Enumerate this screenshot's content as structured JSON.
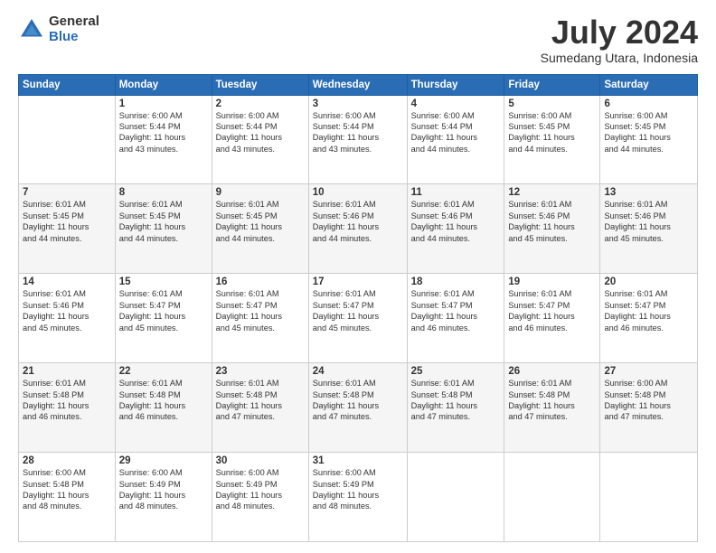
{
  "logo": {
    "general": "General",
    "blue": "Blue"
  },
  "header": {
    "month": "July 2024",
    "location": "Sumedang Utara, Indonesia"
  },
  "weekdays": [
    "Sunday",
    "Monday",
    "Tuesday",
    "Wednesday",
    "Thursday",
    "Friday",
    "Saturday"
  ],
  "weeks": [
    [
      {
        "day": "",
        "info": ""
      },
      {
        "day": "1",
        "info": "Sunrise: 6:00 AM\nSunset: 5:44 PM\nDaylight: 11 hours\nand 43 minutes."
      },
      {
        "day": "2",
        "info": "Sunrise: 6:00 AM\nSunset: 5:44 PM\nDaylight: 11 hours\nand 43 minutes."
      },
      {
        "day": "3",
        "info": "Sunrise: 6:00 AM\nSunset: 5:44 PM\nDaylight: 11 hours\nand 43 minutes."
      },
      {
        "day": "4",
        "info": "Sunrise: 6:00 AM\nSunset: 5:44 PM\nDaylight: 11 hours\nand 44 minutes."
      },
      {
        "day": "5",
        "info": "Sunrise: 6:00 AM\nSunset: 5:45 PM\nDaylight: 11 hours\nand 44 minutes."
      },
      {
        "day": "6",
        "info": "Sunrise: 6:00 AM\nSunset: 5:45 PM\nDaylight: 11 hours\nand 44 minutes."
      }
    ],
    [
      {
        "day": "7",
        "info": "Sunrise: 6:01 AM\nSunset: 5:45 PM\nDaylight: 11 hours\nand 44 minutes."
      },
      {
        "day": "8",
        "info": "Sunrise: 6:01 AM\nSunset: 5:45 PM\nDaylight: 11 hours\nand 44 minutes."
      },
      {
        "day": "9",
        "info": "Sunrise: 6:01 AM\nSunset: 5:45 PM\nDaylight: 11 hours\nand 44 minutes."
      },
      {
        "day": "10",
        "info": "Sunrise: 6:01 AM\nSunset: 5:46 PM\nDaylight: 11 hours\nand 44 minutes."
      },
      {
        "day": "11",
        "info": "Sunrise: 6:01 AM\nSunset: 5:46 PM\nDaylight: 11 hours\nand 44 minutes."
      },
      {
        "day": "12",
        "info": "Sunrise: 6:01 AM\nSunset: 5:46 PM\nDaylight: 11 hours\nand 45 minutes."
      },
      {
        "day": "13",
        "info": "Sunrise: 6:01 AM\nSunset: 5:46 PM\nDaylight: 11 hours\nand 45 minutes."
      }
    ],
    [
      {
        "day": "14",
        "info": "Sunrise: 6:01 AM\nSunset: 5:46 PM\nDaylight: 11 hours\nand 45 minutes."
      },
      {
        "day": "15",
        "info": "Sunrise: 6:01 AM\nSunset: 5:47 PM\nDaylight: 11 hours\nand 45 minutes."
      },
      {
        "day": "16",
        "info": "Sunrise: 6:01 AM\nSunset: 5:47 PM\nDaylight: 11 hours\nand 45 minutes."
      },
      {
        "day": "17",
        "info": "Sunrise: 6:01 AM\nSunset: 5:47 PM\nDaylight: 11 hours\nand 45 minutes."
      },
      {
        "day": "18",
        "info": "Sunrise: 6:01 AM\nSunset: 5:47 PM\nDaylight: 11 hours\nand 46 minutes."
      },
      {
        "day": "19",
        "info": "Sunrise: 6:01 AM\nSunset: 5:47 PM\nDaylight: 11 hours\nand 46 minutes."
      },
      {
        "day": "20",
        "info": "Sunrise: 6:01 AM\nSunset: 5:47 PM\nDaylight: 11 hours\nand 46 minutes."
      }
    ],
    [
      {
        "day": "21",
        "info": "Sunrise: 6:01 AM\nSunset: 5:48 PM\nDaylight: 11 hours\nand 46 minutes."
      },
      {
        "day": "22",
        "info": "Sunrise: 6:01 AM\nSunset: 5:48 PM\nDaylight: 11 hours\nand 46 minutes."
      },
      {
        "day": "23",
        "info": "Sunrise: 6:01 AM\nSunset: 5:48 PM\nDaylight: 11 hours\nand 47 minutes."
      },
      {
        "day": "24",
        "info": "Sunrise: 6:01 AM\nSunset: 5:48 PM\nDaylight: 11 hours\nand 47 minutes."
      },
      {
        "day": "25",
        "info": "Sunrise: 6:01 AM\nSunset: 5:48 PM\nDaylight: 11 hours\nand 47 minutes."
      },
      {
        "day": "26",
        "info": "Sunrise: 6:01 AM\nSunset: 5:48 PM\nDaylight: 11 hours\nand 47 minutes."
      },
      {
        "day": "27",
        "info": "Sunrise: 6:00 AM\nSunset: 5:48 PM\nDaylight: 11 hours\nand 47 minutes."
      }
    ],
    [
      {
        "day": "28",
        "info": "Sunrise: 6:00 AM\nSunset: 5:48 PM\nDaylight: 11 hours\nand 48 minutes."
      },
      {
        "day": "29",
        "info": "Sunrise: 6:00 AM\nSunset: 5:49 PM\nDaylight: 11 hours\nand 48 minutes."
      },
      {
        "day": "30",
        "info": "Sunrise: 6:00 AM\nSunset: 5:49 PM\nDaylight: 11 hours\nand 48 minutes."
      },
      {
        "day": "31",
        "info": "Sunrise: 6:00 AM\nSunset: 5:49 PM\nDaylight: 11 hours\nand 48 minutes."
      },
      {
        "day": "",
        "info": ""
      },
      {
        "day": "",
        "info": ""
      },
      {
        "day": "",
        "info": ""
      }
    ]
  ]
}
